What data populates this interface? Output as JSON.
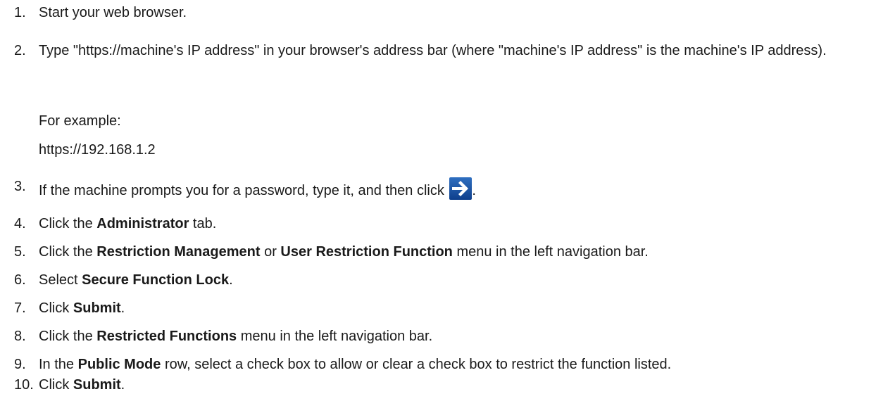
{
  "steps": [
    {
      "num": "1.",
      "text": "Start your web browser."
    },
    {
      "num": "2.",
      "text": "Type \"https://machine's IP address\" in your browser's address bar (where \"machine's IP address\" is the machine's IP address).",
      "example_label": "For example:",
      "example_value": "https://192.168.1.2"
    },
    {
      "num": "3.",
      "text_before": "If the machine prompts you for a password, type it, and then click ",
      "text_after": ".",
      "icon": "arrow-right-icon"
    },
    {
      "num": "4.",
      "pre": "Click the ",
      "bold": "Administrator",
      "post": " tab."
    },
    {
      "num": "5.",
      "pre": "Click the ",
      "bold1": "Restriction Management",
      "mid": " or ",
      "bold2": "User Restriction Function",
      "post": " menu in the left navigation bar."
    },
    {
      "num": "6.",
      "pre": "Select ",
      "bold": "Secure Function Lock",
      "post": "."
    },
    {
      "num": "7.",
      "pre": "Click ",
      "bold": "Submit",
      "post": "."
    },
    {
      "num": "8.",
      "pre": "Click the ",
      "bold": "Restricted Functions",
      "post": " menu in the left navigation bar."
    },
    {
      "num": "9.",
      "pre": "In the ",
      "bold": "Public Mode",
      "post": " row, select a check box to allow or clear a check box to restrict the function listed."
    },
    {
      "num": "10.",
      "pre": "Click ",
      "bold": "Submit",
      "post": "."
    }
  ],
  "colors": {
    "text": "#1a1a1a",
    "arrow_button": "#1f5aa8"
  }
}
